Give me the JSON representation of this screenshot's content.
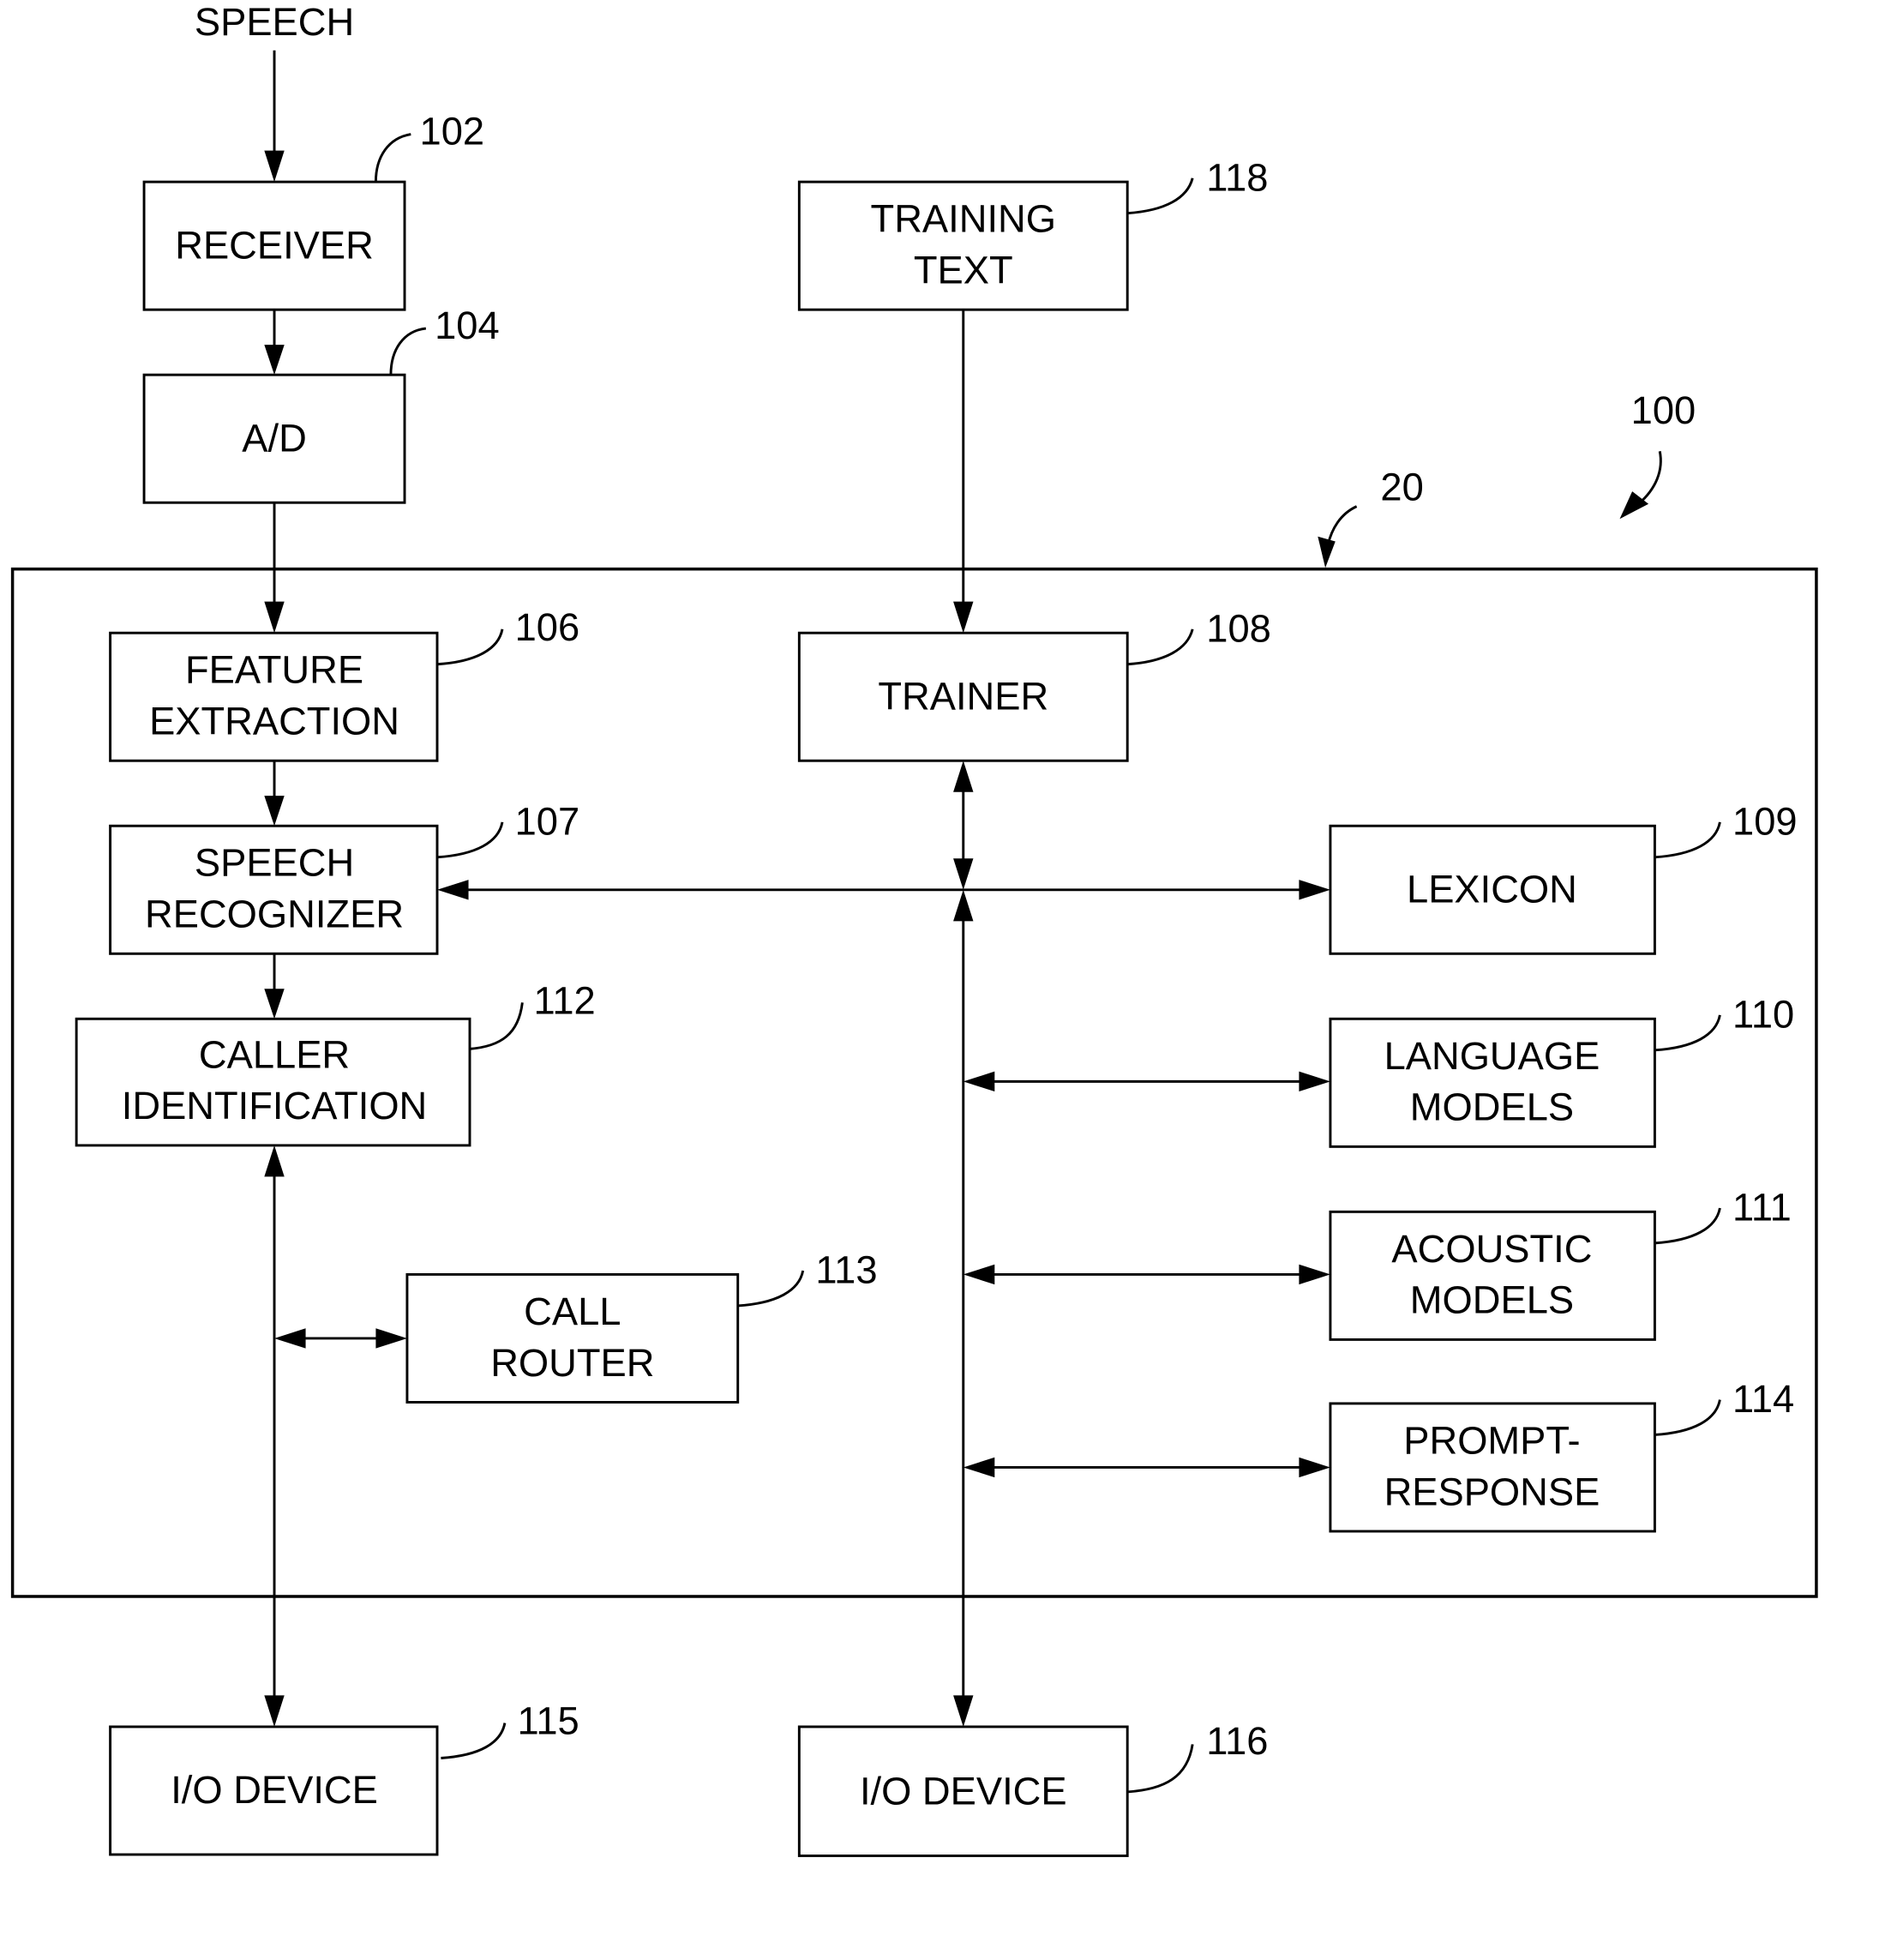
{
  "figure": {
    "input_label": "SPEECH",
    "system_ref": "100",
    "computer_ref": "20"
  },
  "blocks": {
    "receiver": {
      "lines": [
        "RECEIVER"
      ],
      "ref": "102"
    },
    "ad": {
      "lines": [
        "A/D"
      ],
      "ref": "104"
    },
    "training_text": {
      "lines": [
        "TRAINING",
        "TEXT"
      ],
      "ref": "118"
    },
    "feature_extraction": {
      "lines": [
        "FEATURE",
        "EXTRACTION"
      ],
      "ref": "106"
    },
    "trainer": {
      "lines": [
        "TRAINER"
      ],
      "ref": "108"
    },
    "speech_recognizer": {
      "lines": [
        "SPEECH",
        "RECOGNIZER"
      ],
      "ref": "107"
    },
    "lexicon": {
      "lines": [
        "LEXICON"
      ],
      "ref": "109"
    },
    "caller_identification": {
      "lines": [
        "CALLER",
        "IDENTIFICATION"
      ],
      "ref": "112"
    },
    "language_models": {
      "lines": [
        "LANGUAGE",
        "MODELS"
      ],
      "ref": "110"
    },
    "acoustic_models": {
      "lines": [
        "ACOUSTIC",
        "MODELS"
      ],
      "ref": "111"
    },
    "call_router": {
      "lines": [
        "CALL",
        "ROUTER"
      ],
      "ref": "113"
    },
    "prompt_response": {
      "lines": [
        "PROMPT-",
        "RESPONSE"
      ],
      "ref": "114"
    },
    "io_device_1": {
      "lines": [
        "I/O DEVICE"
      ],
      "ref": "115"
    },
    "io_device_2": {
      "lines": [
        "I/O DEVICE"
      ],
      "ref": "116"
    }
  }
}
